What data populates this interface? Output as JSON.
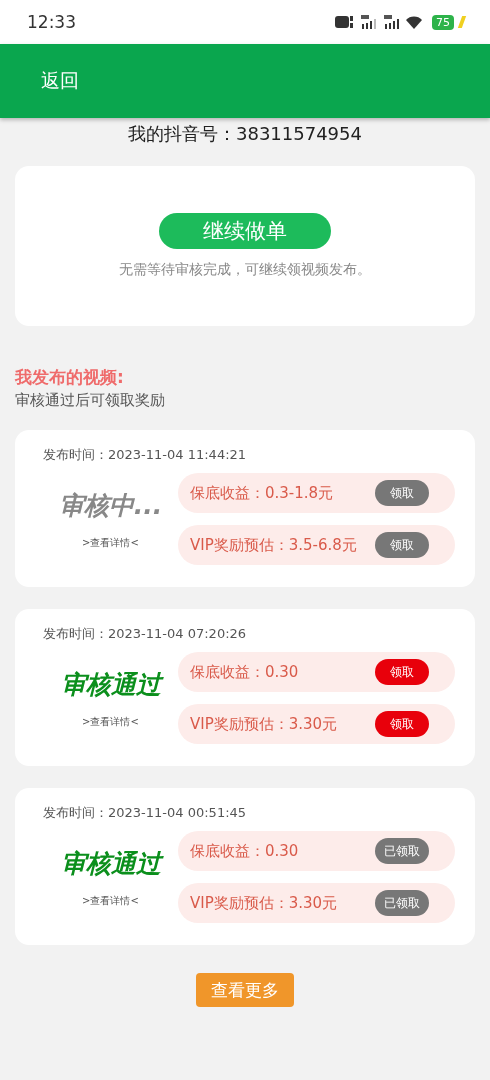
{
  "status_bar": {
    "time": "12:33",
    "battery": "75"
  },
  "header": {
    "back": "返回"
  },
  "account": "我的抖音号：38311574954",
  "task_card": {
    "button": "继续做单",
    "note": "无需等待审核完成，可继续领视频发布。"
  },
  "section": {
    "title": "我发布的视频:",
    "subtitle": "审核通过后可领取奖励"
  },
  "videos": [
    {
      "time": "发布时间：2023-11-04 11:44:21",
      "status": "审核中...",
      "kind": "reviewing",
      "details": ">查看详情<",
      "rewards": [
        {
          "label": "保底收益：0.3-1.8元",
          "button": "领取",
          "disabled": true
        },
        {
          "label": "VIP奖励预估：3.5-6.8元",
          "button": "领取",
          "disabled": true
        }
      ]
    },
    {
      "time": "发布时间：2023-11-04 07:20:26",
      "status": "审核通过",
      "kind": "approved",
      "details": ">查看详情<",
      "rewards": [
        {
          "label": "保底收益：0.30",
          "button": "领取",
          "disabled": false
        },
        {
          "label": "VIP奖励预估：3.30元",
          "button": "领取",
          "disabled": false
        }
      ]
    },
    {
      "time": "发布时间：2023-11-04 00:51:45",
      "status": "审核通过",
      "kind": "approved",
      "details": ">查看详情<",
      "rewards": [
        {
          "label": "保底收益：0.30",
          "button": "已领取",
          "disabled": true
        },
        {
          "label": "VIP奖励预估：3.30元",
          "button": "已领取",
          "disabled": true
        }
      ]
    }
  ],
  "more_button": "查看更多"
}
